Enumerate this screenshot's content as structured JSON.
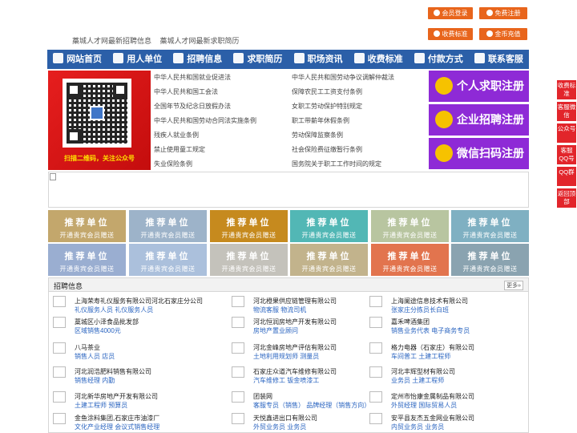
{
  "header": {
    "links": [
      "藁城人才网最新招聘信息",
      "藁城人才网最新求职简历"
    ],
    "buttons": [
      "会员登录",
      "免费注册",
      "收费标准",
      "金币充值"
    ]
  },
  "nav": {
    "items": [
      {
        "label": "网站首页",
        "icon": "home-icon"
      },
      {
        "label": "用人单位",
        "icon": "building-icon"
      },
      {
        "label": "招聘信息",
        "icon": "recruit-icon"
      },
      {
        "label": "求职简历",
        "icon": "resume-icon"
      },
      {
        "label": "职场资讯",
        "icon": "news-icon"
      },
      {
        "label": "收费标准",
        "icon": "fee-icon"
      },
      {
        "label": "付款方式",
        "icon": "payment-icon"
      },
      {
        "label": "联系客服",
        "icon": "service-icon"
      }
    ]
  },
  "qr_banner": {
    "caption": "扫描二维码，关注公众号"
  },
  "laws": [
    [
      "中华人民共和国就业促进法",
      "中华人民共和国劳动争议调解仲裁法"
    ],
    [
      "中华人民共和国工会法",
      "保障农民工工资支付条例"
    ],
    [
      "全国年节及纪念日放假办法",
      "女职工劳动保护特别规定"
    ],
    [
      "中华人民共和国劳动合同法实施条例",
      "职工带薪年休假条例"
    ],
    [
      "残疾人就业条例",
      "劳动保障监察条例"
    ],
    [
      "禁止使用童工规定",
      "社会保险费征缴暂行条例"
    ],
    [
      "失业保险条例",
      "国务院关于职工工作时间的规定"
    ]
  ],
  "register": [
    "个人求职注册",
    "企业招聘注册",
    "微信扫码注册"
  ],
  "promo": {
    "title": "推荐单位",
    "subtitle": "开通贵宾会员赠送",
    "colors": [
      "#c3a76c",
      "#9db3c9",
      "#c68a1e",
      "#52b7b5",
      "#b8c5a0",
      "#7fb0c2",
      "#9aaed1",
      "#abc0dc",
      "#c4c2bb",
      "#c2b38c",
      "#e2744e",
      "#8aa3b0"
    ]
  },
  "jobs": {
    "title": "招聘信息",
    "more": "更多»",
    "list": [
      {
        "company": "上海荣寿礼仪服务有限公司河北石家庄分公司",
        "positions": "礼仪服务人员 礼仪服务人员"
      },
      {
        "company": "河北橙果供应链管理有限公司",
        "positions": "物流客服 物流司机"
      },
      {
        "company": "上海阑途信息技术有限公司",
        "positions": "张家庄分拣员长白班"
      },
      {
        "company": "藁城区小泽食品批发部",
        "positions": "区域销售4000元"
      },
      {
        "company": "河北恒润房地产开发有限公司",
        "positions": "房地产置业顾问"
      },
      {
        "company": "嘉禾啤酒集团",
        "positions": "销售业务代表 电子商务专员"
      },
      {
        "company": "八马茶业",
        "positions": "销售人员 店员"
      },
      {
        "company": "河北金峰房地产评估有限公司",
        "positions": "土地利用规划师 测量员"
      },
      {
        "company": "格力电器（石家庄）有限公司",
        "positions": "车间普工 土建工程师"
      },
      {
        "company": "河北润浩肥料销售有限公司",
        "positions": "销售经理 内勤"
      },
      {
        "company": "石家庄众道汽车维修有限公司",
        "positions": "汽车维修工 钣金喷漆工"
      },
      {
        "company": "河北丰辉型材有限公司",
        "positions": "业务员 土建工程师"
      },
      {
        "company": "河北新华房地产开发有限公司",
        "positions": "土建工程师 预算员"
      },
      {
        "company": "团装网",
        "positions": "客服专员（销售） 品牌经理（销售方向）"
      },
      {
        "company": "定州市怡康金属制品有限公司",
        "positions": "外贸经理 国际贸易人员"
      },
      {
        "company": "金鱼涂料集团,石家庄市油漆厂",
        "positions": "文化产业经理 会议式销售经理"
      },
      {
        "company": "天悦鑫进出口有限公司",
        "positions": "外贸业务员 业务员"
      },
      {
        "company": "安平县友杰五金网业有限公司",
        "positions": "内贸业务员 业务员"
      }
    ]
  },
  "side": [
    "收费标准",
    "客服微信",
    "公众号",
    "客服QQ号",
    "QQ群",
    "返回顶部"
  ]
}
